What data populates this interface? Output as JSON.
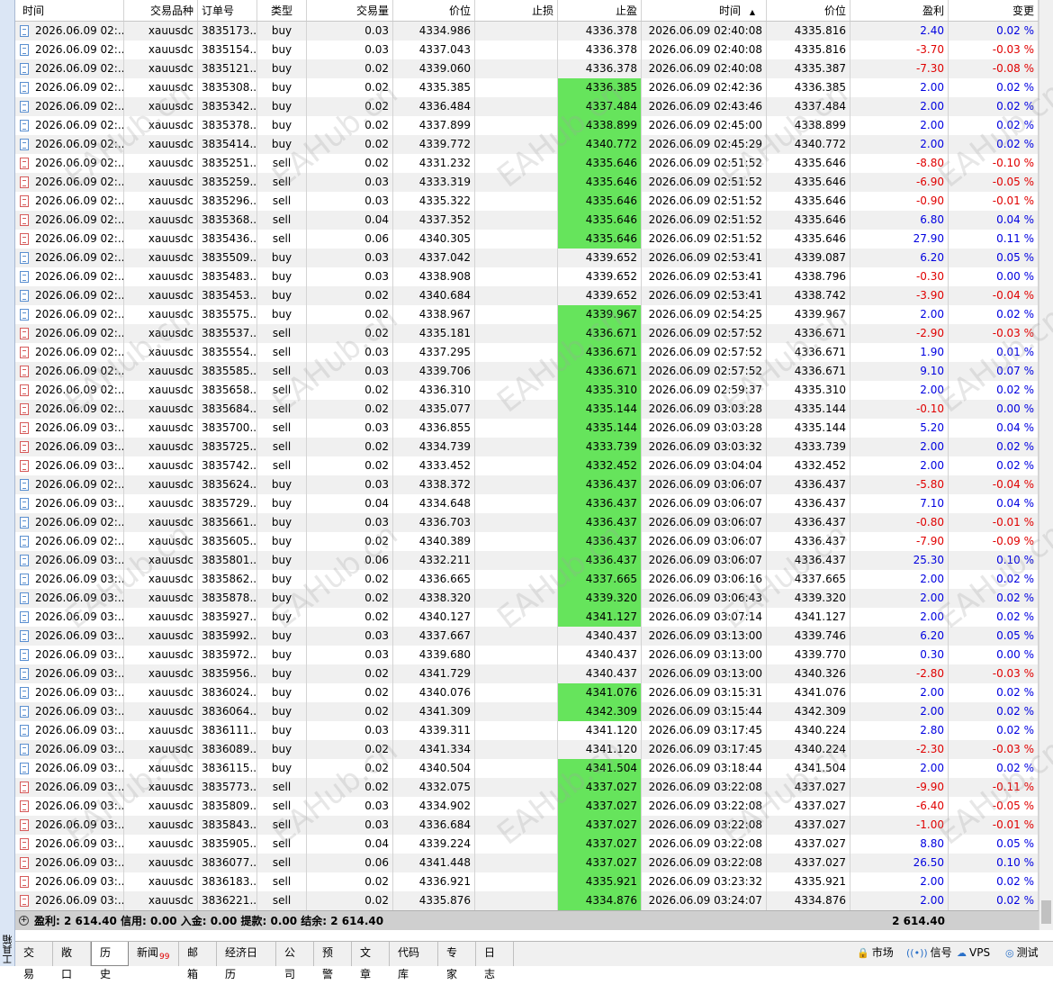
{
  "side_panel": {
    "label": "工具箱"
  },
  "columns": [
    "时间",
    "交易品种",
    "订单号",
    "类型",
    "交易量",
    "价位",
    "止损",
    "止盈",
    "时间",
    "价位",
    "盈利",
    "变更"
  ],
  "sort_indicator": "▲",
  "rows": [
    {
      "time": "2026.06.09 02:...",
      "symbol": "xauusdc",
      "order": "3835173...",
      "type": "buy",
      "volume": "0.03",
      "price": "4334.986",
      "sl": "",
      "tp": "4336.378",
      "tp_hit": false,
      "close_time": "2026.06.09 02:40:08",
      "close_price": "4335.816",
      "profit": "2.40",
      "change": "0.02 %"
    },
    {
      "time": "2026.06.09 02:...",
      "symbol": "xauusdc",
      "order": "3835154...",
      "type": "buy",
      "volume": "0.03",
      "price": "4337.043",
      "sl": "",
      "tp": "4336.378",
      "tp_hit": false,
      "close_time": "2026.06.09 02:40:08",
      "close_price": "4335.816",
      "profit": "-3.70",
      "change": "-0.03 %"
    },
    {
      "time": "2026.06.09 02:...",
      "symbol": "xauusdc",
      "order": "3835121...",
      "type": "buy",
      "volume": "0.02",
      "price": "4339.060",
      "sl": "",
      "tp": "4336.378",
      "tp_hit": false,
      "close_time": "2026.06.09 02:40:08",
      "close_price": "4335.387",
      "profit": "-7.30",
      "change": "-0.08 %"
    },
    {
      "time": "2026.06.09 02:...",
      "symbol": "xauusdc",
      "order": "3835308...",
      "type": "buy",
      "volume": "0.02",
      "price": "4335.385",
      "sl": "",
      "tp": "4336.385",
      "tp_hit": true,
      "close_time": "2026.06.09 02:42:36",
      "close_price": "4336.385",
      "profit": "2.00",
      "change": "0.02 %"
    },
    {
      "time": "2026.06.09 02:...",
      "symbol": "xauusdc",
      "order": "3835342...",
      "type": "buy",
      "volume": "0.02",
      "price": "4336.484",
      "sl": "",
      "tp": "4337.484",
      "tp_hit": true,
      "close_time": "2026.06.09 02:43:46",
      "close_price": "4337.484",
      "profit": "2.00",
      "change": "0.02 %"
    },
    {
      "time": "2026.06.09 02:...",
      "symbol": "xauusdc",
      "order": "3835378...",
      "type": "buy",
      "volume": "0.02",
      "price": "4337.899",
      "sl": "",
      "tp": "4338.899",
      "tp_hit": true,
      "close_time": "2026.06.09 02:45:00",
      "close_price": "4338.899",
      "profit": "2.00",
      "change": "0.02 %"
    },
    {
      "time": "2026.06.09 02:...",
      "symbol": "xauusdc",
      "order": "3835414...",
      "type": "buy",
      "volume": "0.02",
      "price": "4339.772",
      "sl": "",
      "tp": "4340.772",
      "tp_hit": true,
      "close_time": "2026.06.09 02:45:29",
      "close_price": "4340.772",
      "profit": "2.00",
      "change": "0.02 %"
    },
    {
      "time": "2026.06.09 02:...",
      "symbol": "xauusdc",
      "order": "3835251...",
      "type": "sell",
      "volume": "0.02",
      "price": "4331.232",
      "sl": "",
      "tp": "4335.646",
      "tp_hit": true,
      "close_time": "2026.06.09 02:51:52",
      "close_price": "4335.646",
      "profit": "-8.80",
      "change": "-0.10 %"
    },
    {
      "time": "2026.06.09 02:...",
      "symbol": "xauusdc",
      "order": "3835259...",
      "type": "sell",
      "volume": "0.03",
      "price": "4333.319",
      "sl": "",
      "tp": "4335.646",
      "tp_hit": true,
      "close_time": "2026.06.09 02:51:52",
      "close_price": "4335.646",
      "profit": "-6.90",
      "change": "-0.05 %"
    },
    {
      "time": "2026.06.09 02:...",
      "symbol": "xauusdc",
      "order": "3835296...",
      "type": "sell",
      "volume": "0.03",
      "price": "4335.322",
      "sl": "",
      "tp": "4335.646",
      "tp_hit": true,
      "close_time": "2026.06.09 02:51:52",
      "close_price": "4335.646",
      "profit": "-0.90",
      "change": "-0.01 %"
    },
    {
      "time": "2026.06.09 02:...",
      "symbol": "xauusdc",
      "order": "3835368...",
      "type": "sell",
      "volume": "0.04",
      "price": "4337.352",
      "sl": "",
      "tp": "4335.646",
      "tp_hit": true,
      "close_time": "2026.06.09 02:51:52",
      "close_price": "4335.646",
      "profit": "6.80",
      "change": "0.04 %"
    },
    {
      "time": "2026.06.09 02:...",
      "symbol": "xauusdc",
      "order": "3835436...",
      "type": "sell",
      "volume": "0.06",
      "price": "4340.305",
      "sl": "",
      "tp": "4335.646",
      "tp_hit": true,
      "close_time": "2026.06.09 02:51:52",
      "close_price": "4335.646",
      "profit": "27.90",
      "change": "0.11 %"
    },
    {
      "time": "2026.06.09 02:...",
      "symbol": "xauusdc",
      "order": "3835509...",
      "type": "buy",
      "volume": "0.03",
      "price": "4337.042",
      "sl": "",
      "tp": "4339.652",
      "tp_hit": false,
      "close_time": "2026.06.09 02:53:41",
      "close_price": "4339.087",
      "profit": "6.20",
      "change": "0.05 %"
    },
    {
      "time": "2026.06.09 02:...",
      "symbol": "xauusdc",
      "order": "3835483...",
      "type": "buy",
      "volume": "0.03",
      "price": "4338.908",
      "sl": "",
      "tp": "4339.652",
      "tp_hit": false,
      "close_time": "2026.06.09 02:53:41",
      "close_price": "4338.796",
      "profit": "-0.30",
      "change": "0.00 %"
    },
    {
      "time": "2026.06.09 02:...",
      "symbol": "xauusdc",
      "order": "3835453...",
      "type": "buy",
      "volume": "0.02",
      "price": "4340.684",
      "sl": "",
      "tp": "4339.652",
      "tp_hit": false,
      "close_time": "2026.06.09 02:53:41",
      "close_price": "4338.742",
      "profit": "-3.90",
      "change": "-0.04 %"
    },
    {
      "time": "2026.06.09 02:...",
      "symbol": "xauusdc",
      "order": "3835575...",
      "type": "buy",
      "volume": "0.02",
      "price": "4338.967",
      "sl": "",
      "tp": "4339.967",
      "tp_hit": true,
      "close_time": "2026.06.09 02:54:25",
      "close_price": "4339.967",
      "profit": "2.00",
      "change": "0.02 %"
    },
    {
      "time": "2026.06.09 02:...",
      "symbol": "xauusdc",
      "order": "3835537...",
      "type": "sell",
      "volume": "0.02",
      "price": "4335.181",
      "sl": "",
      "tp": "4336.671",
      "tp_hit": true,
      "close_time": "2026.06.09 02:57:52",
      "close_price": "4336.671",
      "profit": "-2.90",
      "change": "-0.03 %"
    },
    {
      "time": "2026.06.09 02:...",
      "symbol": "xauusdc",
      "order": "3835554...",
      "type": "sell",
      "volume": "0.03",
      "price": "4337.295",
      "sl": "",
      "tp": "4336.671",
      "tp_hit": true,
      "close_time": "2026.06.09 02:57:52",
      "close_price": "4336.671",
      "profit": "1.90",
      "change": "0.01 %"
    },
    {
      "time": "2026.06.09 02:...",
      "symbol": "xauusdc",
      "order": "3835585...",
      "type": "sell",
      "volume": "0.03",
      "price": "4339.706",
      "sl": "",
      "tp": "4336.671",
      "tp_hit": true,
      "close_time": "2026.06.09 02:57:52",
      "close_price": "4336.671",
      "profit": "9.10",
      "change": "0.07 %"
    },
    {
      "time": "2026.06.09 02:...",
      "symbol": "xauusdc",
      "order": "3835658...",
      "type": "sell",
      "volume": "0.02",
      "price": "4336.310",
      "sl": "",
      "tp": "4335.310",
      "tp_hit": true,
      "close_time": "2026.06.09 02:59:37",
      "close_price": "4335.310",
      "profit": "2.00",
      "change": "0.02 %"
    },
    {
      "time": "2026.06.09 02:...",
      "symbol": "xauusdc",
      "order": "3835684...",
      "type": "sell",
      "volume": "0.02",
      "price": "4335.077",
      "sl": "",
      "tp": "4335.144",
      "tp_hit": true,
      "close_time": "2026.06.09 03:03:28",
      "close_price": "4335.144",
      "profit": "-0.10",
      "change": "0.00 %"
    },
    {
      "time": "2026.06.09 03:...",
      "symbol": "xauusdc",
      "order": "3835700...",
      "type": "sell",
      "volume": "0.03",
      "price": "4336.855",
      "sl": "",
      "tp": "4335.144",
      "tp_hit": true,
      "close_time": "2026.06.09 03:03:28",
      "close_price": "4335.144",
      "profit": "5.20",
      "change": "0.04 %"
    },
    {
      "time": "2026.06.09 03:...",
      "symbol": "xauusdc",
      "order": "3835725...",
      "type": "sell",
      "volume": "0.02",
      "price": "4334.739",
      "sl": "",
      "tp": "4333.739",
      "tp_hit": true,
      "close_time": "2026.06.09 03:03:32",
      "close_price": "4333.739",
      "profit": "2.00",
      "change": "0.02 %"
    },
    {
      "time": "2026.06.09 03:...",
      "symbol": "xauusdc",
      "order": "3835742...",
      "type": "sell",
      "volume": "0.02",
      "price": "4333.452",
      "sl": "",
      "tp": "4332.452",
      "tp_hit": true,
      "close_time": "2026.06.09 03:04:04",
      "close_price": "4332.452",
      "profit": "2.00",
      "change": "0.02 %"
    },
    {
      "time": "2026.06.09 02:...",
      "symbol": "xauusdc",
      "order": "3835624...",
      "type": "buy",
      "volume": "0.03",
      "price": "4338.372",
      "sl": "",
      "tp": "4336.437",
      "tp_hit": true,
      "close_time": "2026.06.09 03:06:07",
      "close_price": "4336.437",
      "profit": "-5.80",
      "change": "-0.04 %"
    },
    {
      "time": "2026.06.09 03:...",
      "symbol": "xauusdc",
      "order": "3835729...",
      "type": "buy",
      "volume": "0.04",
      "price": "4334.648",
      "sl": "",
      "tp": "4336.437",
      "tp_hit": true,
      "close_time": "2026.06.09 03:06:07",
      "close_price": "4336.437",
      "profit": "7.10",
      "change": "0.04 %"
    },
    {
      "time": "2026.06.09 02:...",
      "symbol": "xauusdc",
      "order": "3835661...",
      "type": "buy",
      "volume": "0.03",
      "price": "4336.703",
      "sl": "",
      "tp": "4336.437",
      "tp_hit": true,
      "close_time": "2026.06.09 03:06:07",
      "close_price": "4336.437",
      "profit": "-0.80",
      "change": "-0.01 %"
    },
    {
      "time": "2026.06.09 02:...",
      "symbol": "xauusdc",
      "order": "3835605...",
      "type": "buy",
      "volume": "0.02",
      "price": "4340.389",
      "sl": "",
      "tp": "4336.437",
      "tp_hit": true,
      "close_time": "2026.06.09 03:06:07",
      "close_price": "4336.437",
      "profit": "-7.90",
      "change": "-0.09 %"
    },
    {
      "time": "2026.06.09 03:...",
      "symbol": "xauusdc",
      "order": "3835801...",
      "type": "buy",
      "volume": "0.06",
      "price": "4332.211",
      "sl": "",
      "tp": "4336.437",
      "tp_hit": true,
      "close_time": "2026.06.09 03:06:07",
      "close_price": "4336.437",
      "profit": "25.30",
      "change": "0.10 %"
    },
    {
      "time": "2026.06.09 03:...",
      "symbol": "xauusdc",
      "order": "3835862...",
      "type": "buy",
      "volume": "0.02",
      "price": "4336.665",
      "sl": "",
      "tp": "4337.665",
      "tp_hit": true,
      "close_time": "2026.06.09 03:06:16",
      "close_price": "4337.665",
      "profit": "2.00",
      "change": "0.02 %"
    },
    {
      "time": "2026.06.09 03:...",
      "symbol": "xauusdc",
      "order": "3835878...",
      "type": "buy",
      "volume": "0.02",
      "price": "4338.320",
      "sl": "",
      "tp": "4339.320",
      "tp_hit": true,
      "close_time": "2026.06.09 03:06:43",
      "close_price": "4339.320",
      "profit": "2.00",
      "change": "0.02 %"
    },
    {
      "time": "2026.06.09 03:...",
      "symbol": "xauusdc",
      "order": "3835927...",
      "type": "buy",
      "volume": "0.02",
      "price": "4340.127",
      "sl": "",
      "tp": "4341.127",
      "tp_hit": true,
      "close_time": "2026.06.09 03:07:14",
      "close_price": "4341.127",
      "profit": "2.00",
      "change": "0.02 %"
    },
    {
      "time": "2026.06.09 03:...",
      "symbol": "xauusdc",
      "order": "3835992...",
      "type": "buy",
      "volume": "0.03",
      "price": "4337.667",
      "sl": "",
      "tp": "4340.437",
      "tp_hit": false,
      "close_time": "2026.06.09 03:13:00",
      "close_price": "4339.746",
      "profit": "6.20",
      "change": "0.05 %"
    },
    {
      "time": "2026.06.09 03:...",
      "symbol": "xauusdc",
      "order": "3835972...",
      "type": "buy",
      "volume": "0.03",
      "price": "4339.680",
      "sl": "",
      "tp": "4340.437",
      "tp_hit": false,
      "close_time": "2026.06.09 03:13:00",
      "close_price": "4339.770",
      "profit": "0.30",
      "change": "0.00 %"
    },
    {
      "time": "2026.06.09 03:...",
      "symbol": "xauusdc",
      "order": "3835956...",
      "type": "buy",
      "volume": "0.02",
      "price": "4341.729",
      "sl": "",
      "tp": "4340.437",
      "tp_hit": false,
      "close_time": "2026.06.09 03:13:00",
      "close_price": "4340.326",
      "profit": "-2.80",
      "change": "-0.03 %"
    },
    {
      "time": "2026.06.09 03:...",
      "symbol": "xauusdc",
      "order": "3836024...",
      "type": "buy",
      "volume": "0.02",
      "price": "4340.076",
      "sl": "",
      "tp": "4341.076",
      "tp_hit": true,
      "close_time": "2026.06.09 03:15:31",
      "close_price": "4341.076",
      "profit": "2.00",
      "change": "0.02 %"
    },
    {
      "time": "2026.06.09 03:...",
      "symbol": "xauusdc",
      "order": "3836064...",
      "type": "buy",
      "volume": "0.02",
      "price": "4341.309",
      "sl": "",
      "tp": "4342.309",
      "tp_hit": true,
      "close_time": "2026.06.09 03:15:44",
      "close_price": "4342.309",
      "profit": "2.00",
      "change": "0.02 %"
    },
    {
      "time": "2026.06.09 03:...",
      "symbol": "xauusdc",
      "order": "3836111...",
      "type": "buy",
      "volume": "0.03",
      "price": "4339.311",
      "sl": "",
      "tp": "4341.120",
      "tp_hit": false,
      "close_time": "2026.06.09 03:17:45",
      "close_price": "4340.224",
      "profit": "2.80",
      "change": "0.02 %"
    },
    {
      "time": "2026.06.09 03:...",
      "symbol": "xauusdc",
      "order": "3836089...",
      "type": "buy",
      "volume": "0.02",
      "price": "4341.334",
      "sl": "",
      "tp": "4341.120",
      "tp_hit": false,
      "close_time": "2026.06.09 03:17:45",
      "close_price": "4340.224",
      "profit": "-2.30",
      "change": "-0.03 %"
    },
    {
      "time": "2026.06.09 03:...",
      "symbol": "xauusdc",
      "order": "3836115...",
      "type": "buy",
      "volume": "0.02",
      "price": "4340.504",
      "sl": "",
      "tp": "4341.504",
      "tp_hit": true,
      "close_time": "2026.06.09 03:18:44",
      "close_price": "4341.504",
      "profit": "2.00",
      "change": "0.02 %"
    },
    {
      "time": "2026.06.09 03:...",
      "symbol": "xauusdc",
      "order": "3835773...",
      "type": "sell",
      "volume": "0.02",
      "price": "4332.075",
      "sl": "",
      "tp": "4337.027",
      "tp_hit": true,
      "close_time": "2026.06.09 03:22:08",
      "close_price": "4337.027",
      "profit": "-9.90",
      "change": "-0.11 %"
    },
    {
      "time": "2026.06.09 03:...",
      "symbol": "xauusdc",
      "order": "3835809...",
      "type": "sell",
      "volume": "0.03",
      "price": "4334.902",
      "sl": "",
      "tp": "4337.027",
      "tp_hit": true,
      "close_time": "2026.06.09 03:22:08",
      "close_price": "4337.027",
      "profit": "-6.40",
      "change": "-0.05 %"
    },
    {
      "time": "2026.06.09 03:...",
      "symbol": "xauusdc",
      "order": "3835843...",
      "type": "sell",
      "volume": "0.03",
      "price": "4336.684",
      "sl": "",
      "tp": "4337.027",
      "tp_hit": true,
      "close_time": "2026.06.09 03:22:08",
      "close_price": "4337.027",
      "profit": "-1.00",
      "change": "-0.01 %"
    },
    {
      "time": "2026.06.09 03:...",
      "symbol": "xauusdc",
      "order": "3835905...",
      "type": "sell",
      "volume": "0.04",
      "price": "4339.224",
      "sl": "",
      "tp": "4337.027",
      "tp_hit": true,
      "close_time": "2026.06.09 03:22:08",
      "close_price": "4337.027",
      "profit": "8.80",
      "change": "0.05 %"
    },
    {
      "time": "2026.06.09 03:...",
      "symbol": "xauusdc",
      "order": "3836077...",
      "type": "sell",
      "volume": "0.06",
      "price": "4341.448",
      "sl": "",
      "tp": "4337.027",
      "tp_hit": true,
      "close_time": "2026.06.09 03:22:08",
      "close_price": "4337.027",
      "profit": "26.50",
      "change": "0.10 %"
    },
    {
      "time": "2026.06.09 03:...",
      "symbol": "xauusdc",
      "order": "3836183...",
      "type": "sell",
      "volume": "0.02",
      "price": "4336.921",
      "sl": "",
      "tp": "4335.921",
      "tp_hit": true,
      "close_time": "2026.06.09 03:23:32",
      "close_price": "4335.921",
      "profit": "2.00",
      "change": "0.02 %"
    },
    {
      "time": "2026.06.09 03:...",
      "symbol": "xauusdc",
      "order": "3836221...",
      "type": "sell",
      "volume": "0.02",
      "price": "4335.876",
      "sl": "",
      "tp": "4334.876",
      "tp_hit": true,
      "close_time": "2026.06.09 03:24:07",
      "close_price": "4334.876",
      "profit": "2.00",
      "change": "0.02 %"
    }
  ],
  "summary": {
    "text": "盈利: 2 614.40  信用: 0.00  入金: 0.00  提款: 0.00  结余: 2 614.40",
    "total": "2 614.40"
  },
  "tabs": [
    {
      "label": "交易",
      "active": false,
      "badge": ""
    },
    {
      "label": "敞口",
      "active": false,
      "badge": ""
    },
    {
      "label": "历史",
      "active": true,
      "badge": ""
    },
    {
      "label": "新闻",
      "active": false,
      "badge": "99"
    },
    {
      "label": "邮箱",
      "active": false,
      "badge": ""
    },
    {
      "label": "经济日历",
      "active": false,
      "badge": ""
    },
    {
      "label": "公司",
      "active": false,
      "badge": ""
    },
    {
      "label": "预警",
      "active": false,
      "badge": ""
    },
    {
      "label": "文章",
      "active": false,
      "badge": ""
    },
    {
      "label": "代码库",
      "active": false,
      "badge": ""
    },
    {
      "label": "专家",
      "active": false,
      "badge": ""
    },
    {
      "label": "日志",
      "active": false,
      "badge": ""
    }
  ],
  "right_tools": [
    {
      "label": "市场",
      "icon": "market-icon",
      "glyph": "🔒",
      "color": "#d9a000"
    },
    {
      "label": "信号",
      "icon": "signal-icon",
      "glyph": "((•))",
      "color": "#2a70c8"
    },
    {
      "label": "VPS",
      "icon": "cloud-icon",
      "glyph": "☁",
      "color": "#2a70c8"
    },
    {
      "label": "测试",
      "icon": "tester-icon",
      "glyph": "◎",
      "color": "#2a70c8"
    }
  ],
  "colors": {
    "tp_hit": "#66e45c",
    "positive": "#0000e0",
    "negative": "#e00000",
    "row_alt": "#f0f0f0",
    "summary_bg": "#cfcfcf"
  },
  "watermark_text": "EAHub.cn"
}
